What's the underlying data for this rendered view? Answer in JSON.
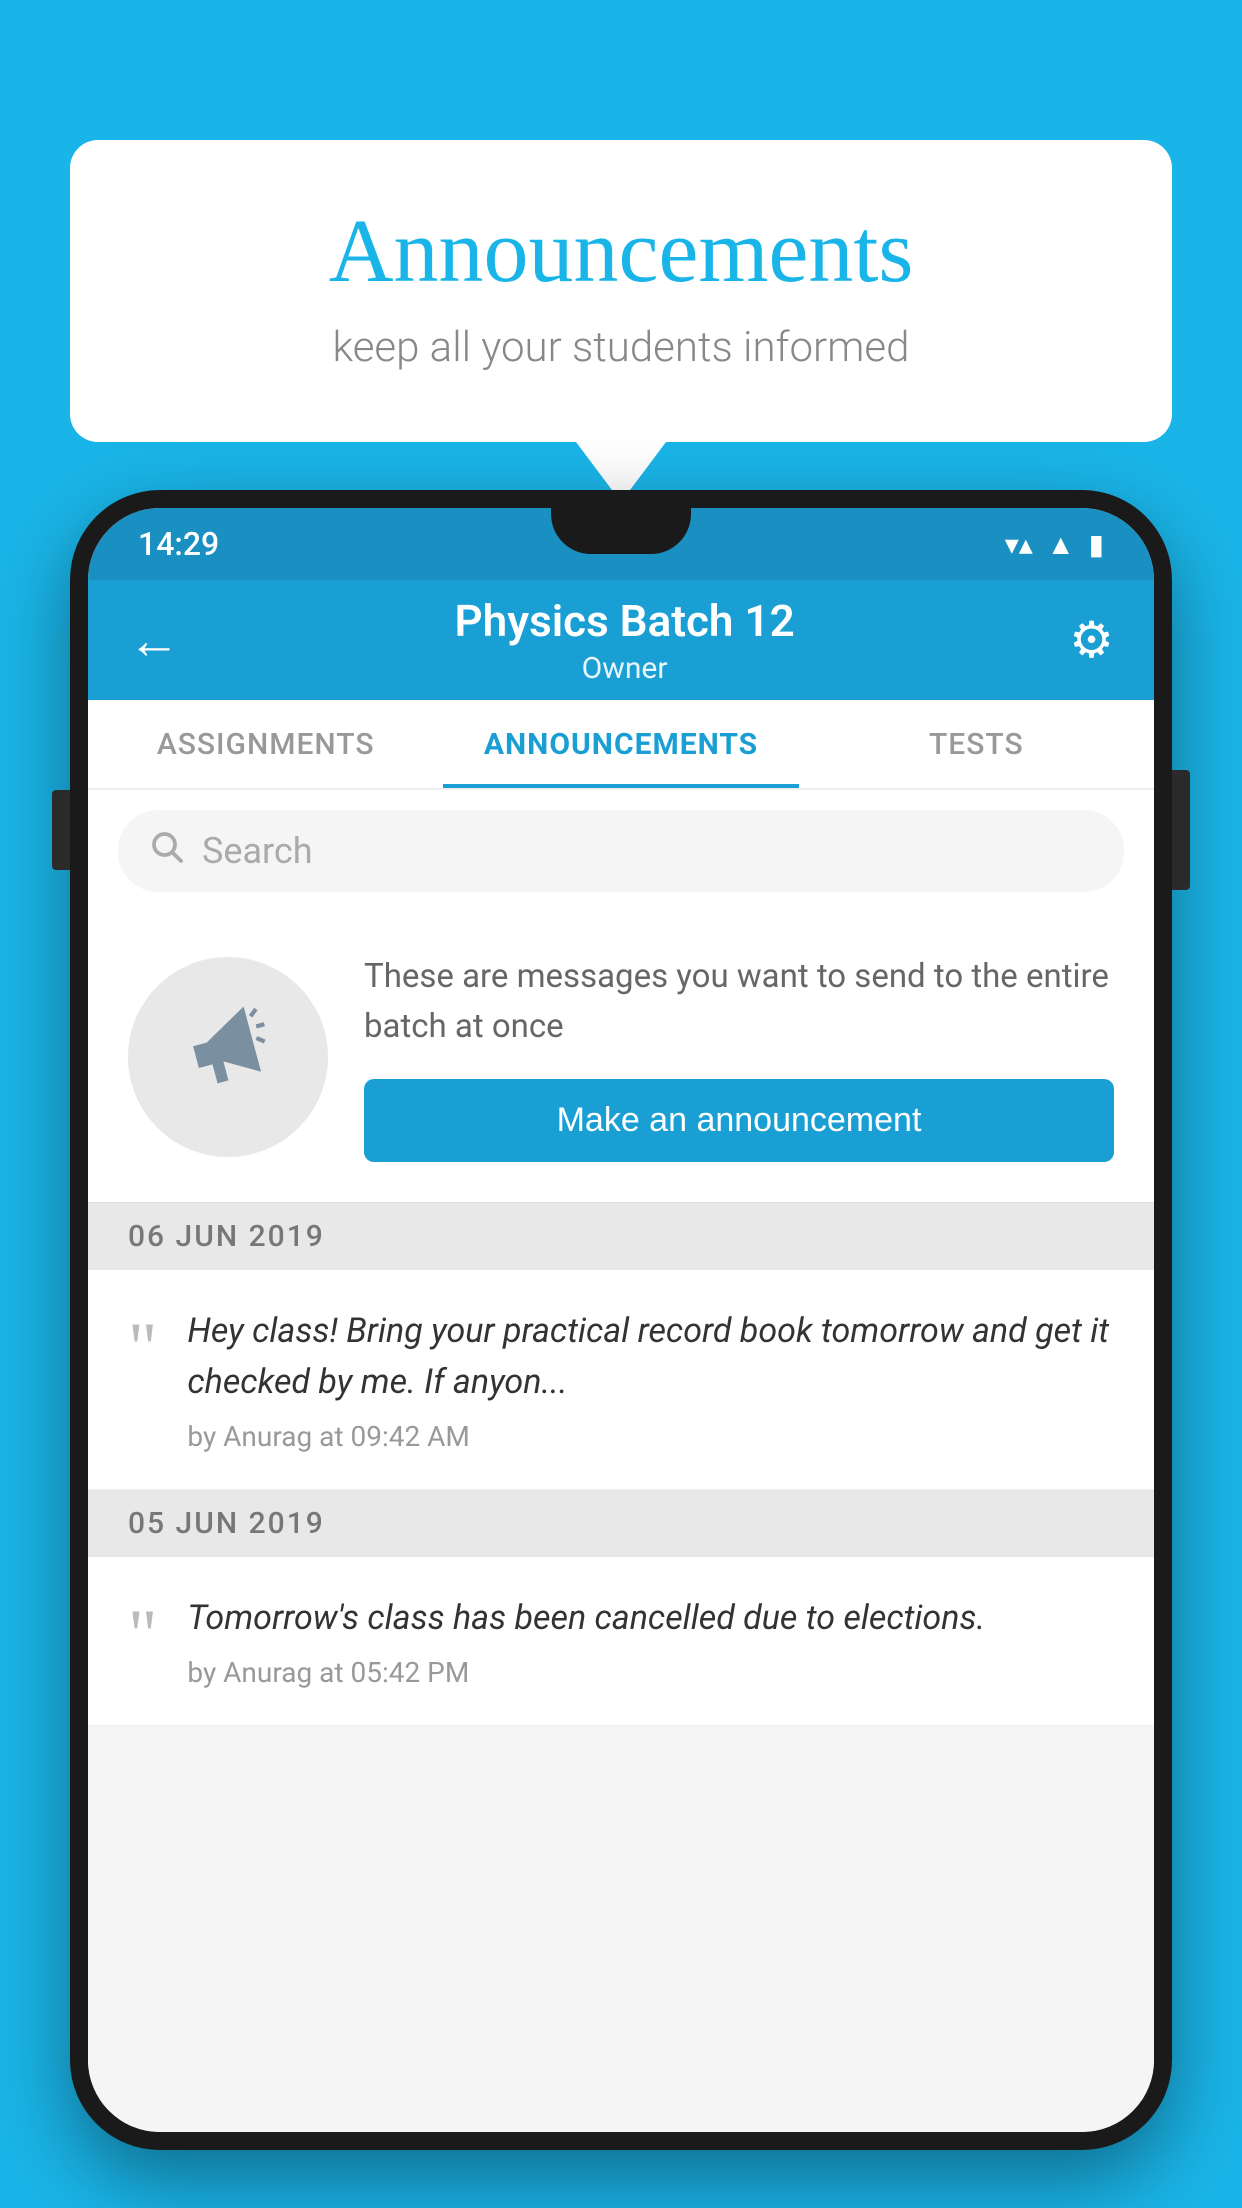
{
  "background_color": "#1ab5e8",
  "speech_bubble": {
    "title": "Announcements",
    "subtitle": "keep all your students informed"
  },
  "phone": {
    "status_bar": {
      "time": "14:29"
    },
    "header": {
      "title": "Physics Batch 12",
      "subtitle": "Owner",
      "back_icon": "←",
      "gear_icon": "⚙"
    },
    "tabs": [
      {
        "label": "ASSIGNMENTS",
        "active": false
      },
      {
        "label": "ANNOUNCEMENTS",
        "active": true
      },
      {
        "label": "TESTS",
        "active": false
      }
    ],
    "search": {
      "placeholder": "Search"
    },
    "promo": {
      "description": "These are messages you want to send to the entire batch at once",
      "button_label": "Make an announcement"
    },
    "announcements": [
      {
        "date": "06  JUN  2019",
        "message": "Hey class! Bring your practical record book tomorrow and get it checked by me. If anyon...",
        "meta": "by Anurag at 09:42 AM"
      },
      {
        "date": "05  JUN  2019",
        "message": "Tomorrow's class has been cancelled due to elections.",
        "meta": "by Anurag at 05:42 PM"
      }
    ]
  }
}
